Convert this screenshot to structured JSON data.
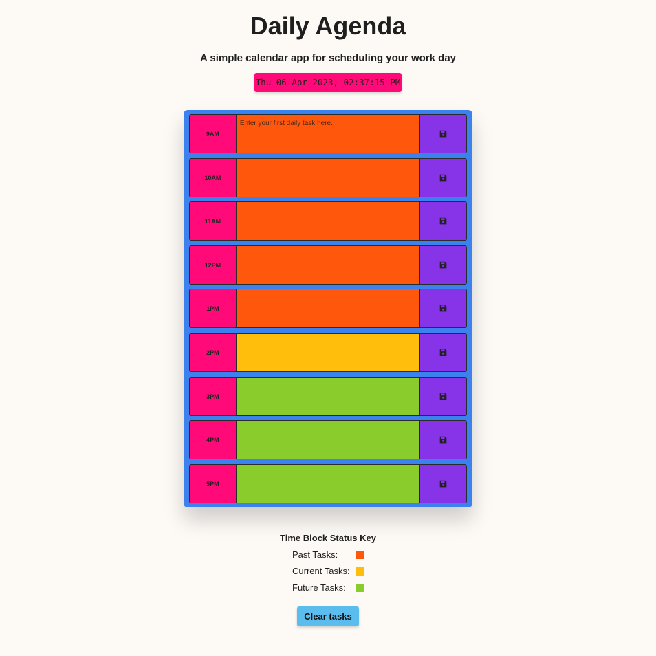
{
  "header": {
    "title": "Daily Agenda",
    "subtitle": "A simple calendar app for scheduling your work day",
    "current_datetime": "Thu 06 Apr 2023, 02:37:15 PM"
  },
  "time_blocks": [
    {
      "hour": "9AM",
      "status": "past",
      "task": "",
      "placeholder": "Enter your first daily task here."
    },
    {
      "hour": "10AM",
      "status": "past",
      "task": "",
      "placeholder": ""
    },
    {
      "hour": "11AM",
      "status": "past",
      "task": "",
      "placeholder": ""
    },
    {
      "hour": "12PM",
      "status": "past",
      "task": "",
      "placeholder": ""
    },
    {
      "hour": "1PM",
      "status": "past",
      "task": "",
      "placeholder": ""
    },
    {
      "hour": "2PM",
      "status": "present",
      "task": "",
      "placeholder": ""
    },
    {
      "hour": "3PM",
      "status": "future",
      "task": "",
      "placeholder": ""
    },
    {
      "hour": "4PM",
      "status": "future",
      "task": "",
      "placeholder": ""
    },
    {
      "hour": "5PM",
      "status": "future",
      "task": "",
      "placeholder": ""
    }
  ],
  "save_icon": "floppy-disk-icon",
  "status_key": {
    "title": "Time Block Status Key",
    "items": [
      {
        "label": "Past Tasks:",
        "color": "#ff570c"
      },
      {
        "label": "Current Tasks:",
        "color": "#ffbe0c"
      },
      {
        "label": "Future Tasks:",
        "color": "#8acc2b"
      }
    ]
  },
  "clear_button": {
    "label": "Clear tasks"
  },
  "colors": {
    "background": "#fdfaf6",
    "planner": "#3b82ee",
    "hour_block": "#ff0a78",
    "save_button": "#8734e8",
    "past": "#ff570c",
    "present": "#ffbe0c",
    "future": "#8acc2b",
    "clear_button": "#5bbdee"
  }
}
